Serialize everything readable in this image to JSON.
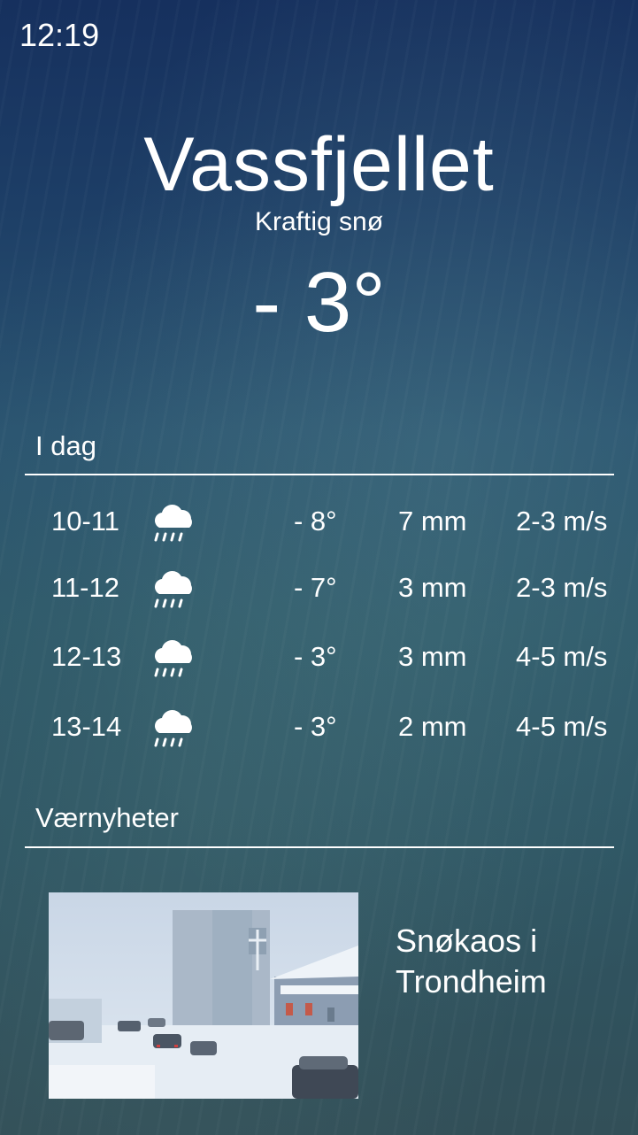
{
  "status_bar": {
    "time": "12:19"
  },
  "location": {
    "name": "Vassfjellet",
    "condition": "Kraftig snø",
    "temperature": "- 3°"
  },
  "today": {
    "title": "I dag",
    "rows": [
      {
        "time": "10-11",
        "icon": "snow-cloud-icon",
        "temp": "- 8°",
        "precip": "7 mm",
        "wind": "2-3 m/s"
      },
      {
        "time": "11-12",
        "icon": "snow-cloud-icon",
        "temp": "- 7°",
        "precip": "3 mm",
        "wind": "2-3 m/s"
      },
      {
        "time": "12-13",
        "icon": "snow-cloud-icon",
        "temp": "- 3°",
        "precip": "3 mm",
        "wind": "4-5 m/s"
      },
      {
        "time": "13-14",
        "icon": "snow-cloud-icon",
        "temp": "- 3°",
        "precip": "2 mm",
        "wind": "4-5 m/s"
      }
    ]
  },
  "news": {
    "title": "Værnyheter",
    "items": [
      {
        "headline": "Snøkaos i Trondheim",
        "image": "snowy-street-photo"
      }
    ]
  },
  "colors": {
    "text": "#ffffff",
    "bg_top": "#16305e",
    "bg_bottom": "#324f58"
  }
}
